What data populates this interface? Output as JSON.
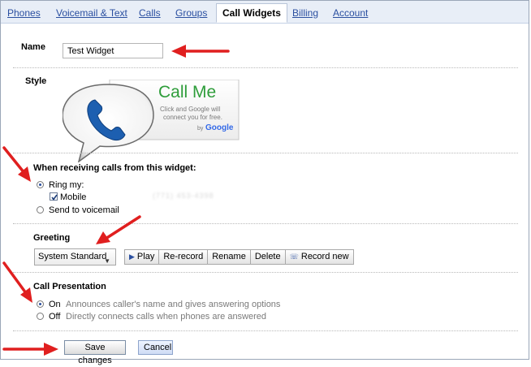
{
  "tabs": [
    {
      "label": "Phones",
      "active": false
    },
    {
      "label": "Voicemail & Text",
      "active": false
    },
    {
      "label": "Calls",
      "active": false
    },
    {
      "label": "Groups",
      "active": false
    },
    {
      "label": "Call Widgets",
      "active": true
    },
    {
      "label": "Billing",
      "active": false
    },
    {
      "label": "Account",
      "active": false
    }
  ],
  "name": {
    "label": "Name",
    "value": "Test Widget"
  },
  "style": {
    "label": "Style",
    "title": "Call Me",
    "line1": "Click and Google will",
    "line2": "connect you for free.",
    "by": "by",
    "brand": "Google"
  },
  "receiving": {
    "title": "When receiving calls from this widget:",
    "ring_label": "Ring my:",
    "mobile_label": "Mobile",
    "mobile_number": "(771) 453-4398",
    "voicemail_label": "Send to voicemail"
  },
  "greeting": {
    "label": "Greeting",
    "selected": "System Standard",
    "buttons": [
      "Play",
      "Re-record",
      "Rename",
      "Delete",
      "Record new"
    ]
  },
  "presentation": {
    "title": "Call Presentation",
    "on_label": "On",
    "on_desc": "Announces caller's name and gives answering options",
    "off_label": "Off",
    "off_desc": "Directly connects calls when phones are answered"
  },
  "actions": {
    "save": "Save changes",
    "cancel": "Cancel"
  },
  "colors": {
    "arrow": "#e01f1f",
    "link": "#2a4fa0",
    "tabbar": "#e8eef7",
    "callme_green": "#2e9d3a",
    "phone_blue": "#1d5fb0"
  }
}
